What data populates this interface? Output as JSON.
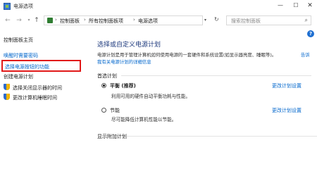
{
  "window": {
    "title": "电源选项",
    "minimize_glyph": "—",
    "maximize_glyph": "☐",
    "close_glyph": "✕"
  },
  "nav": {
    "back_glyph": "←",
    "forward_glyph": "→",
    "recent_glyph": "▾",
    "up_glyph": "↑",
    "breadcrumbs": [
      "控制面板",
      "所有控制面板项",
      "电源选项"
    ],
    "separator": "›",
    "dropdown_glyph": "▾",
    "refresh_glyph": "↻",
    "search_placeholder": "搜索控制面板",
    "search_glyph": "⌕"
  },
  "left_pane": {
    "home": "控制面板主页",
    "links": [
      {
        "label": "唤醒时需要密码"
      },
      {
        "label": "选择电源按钮的功能",
        "highlighted": true
      },
      {
        "label": "创建电源计划"
      },
      {
        "label": "选择关闭显示器的时间",
        "icon": "shield-icon"
      },
      {
        "label": "更改计算机睡眠时间",
        "icon": "shield-icon"
      }
    ],
    "highlight_color": "#e11919"
  },
  "help_glyph": "?",
  "main": {
    "title": "选择或自定义电源计划",
    "description": "电源计划是用于管理计算机如何使用电源的一套硬件和系统设置(如显示器亮度、睡眠等)。",
    "description_link": "告诉",
    "description_link_2": "我有关电源计划的详细信息",
    "section_label": "首选计划",
    "plans": [
      {
        "name": "平衡 (推荐)",
        "description": "利用可用的硬件自动平衡功耗与性能。",
        "change_label": "更改计划设置",
        "selected": true
      },
      {
        "name": "节能",
        "description": "尽可能降低计算机性能以节能。",
        "change_label": "更改计划设置",
        "selected": false
      }
    ],
    "show_more_label": "显示附加计划",
    "expand_glyph": "⌄"
  },
  "colors": {
    "link": "#0066cc",
    "title": "#1e3a7d",
    "highlight": "#e11919"
  }
}
